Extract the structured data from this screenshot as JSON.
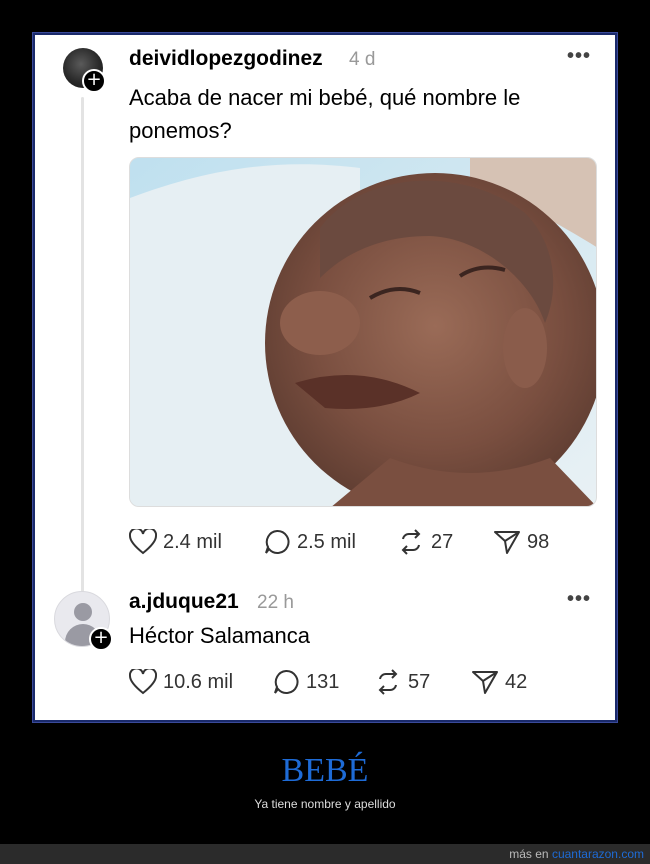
{
  "post": {
    "username": "deividlopezgodinez",
    "time": "4 d",
    "text_line1": "Acaba de nacer mi bebé, qué nombre le",
    "text_line2": "ponemos?",
    "likes": "2.4 mil",
    "replies": "2.5 mil",
    "reposts": "27",
    "shares": "98"
  },
  "reply": {
    "username": "a.jduque21",
    "time": "22 h",
    "text": "Héctor Salamanca",
    "likes": "10.6 mil",
    "replies": "131",
    "reposts": "57",
    "shares": "42"
  },
  "caption": {
    "title": "BEBÉ",
    "subtitle": "Ya tiene nombre y apellido"
  },
  "credit": {
    "prefix": "más en",
    "site": "cuantarazon.com"
  },
  "colors": {
    "accent": "#1e6bd6",
    "background": "#000000"
  }
}
